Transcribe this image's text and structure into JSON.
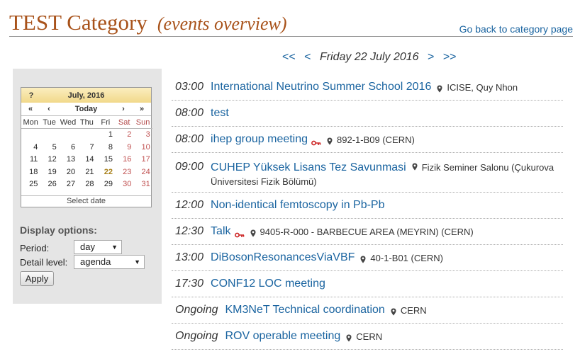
{
  "header": {
    "title": "TEST Category",
    "subtitle": "(events overview)",
    "back_link": "Go back to category page"
  },
  "date_nav": {
    "first": "<<",
    "prev": "<",
    "current": "Friday 22 July 2016",
    "next": ">",
    "last": ">>"
  },
  "calendar": {
    "help": "?",
    "month": "July, 2016",
    "nav_prev_year": "«",
    "nav_prev_month": "‹",
    "today": "Today",
    "nav_next_month": "›",
    "nav_next_year": "»",
    "weekdays": [
      "Mon",
      "Tue",
      "Wed",
      "Thu",
      "Fri",
      "Sat",
      "Sun"
    ],
    "weeks": [
      [
        "",
        "",
        "",
        "",
        "1",
        "2",
        "3"
      ],
      [
        "4",
        "5",
        "6",
        "7",
        "8",
        "9",
        "10"
      ],
      [
        "11",
        "12",
        "13",
        "14",
        "15",
        "16",
        "17"
      ],
      [
        "18",
        "19",
        "20",
        "21",
        "22",
        "23",
        "24"
      ],
      [
        "25",
        "26",
        "27",
        "28",
        "29",
        "30",
        "31"
      ]
    ],
    "selected_day": "22",
    "footer": "Select date"
  },
  "options": {
    "title": "Display options:",
    "period_label": "Period:",
    "period_value": "day",
    "detail_label": "Detail level:",
    "detail_value": "agenda",
    "apply_label": "Apply"
  },
  "events": [
    {
      "time": "03:00",
      "title": "International Neutrino Summer School 2016",
      "protected": false,
      "location": "ICISE, Quy Nhon"
    },
    {
      "time": "08:00",
      "title": "test",
      "protected": false,
      "location": ""
    },
    {
      "time": "08:00",
      "title": "ihep group meeting",
      "protected": true,
      "location": "892-1-B09 (CERN)"
    },
    {
      "time": "09:00",
      "title": "CUHEP Yüksek Lisans Tez Savunmasi",
      "protected": false,
      "location": "Fizik Seminer Salonu (Çukurova Üniversitesi Fizik Bölümü)"
    },
    {
      "time": "12:00",
      "title": "Non-identical femtoscopy in Pb-Pb",
      "protected": false,
      "location": ""
    },
    {
      "time": "12:30",
      "title": "Talk",
      "protected": true,
      "location": "9405-R-000 - BARBECUE AREA (MEYRIN) (CERN)"
    },
    {
      "time": "13:00",
      "title": "DiBosonResonancesViaVBF",
      "protected": false,
      "location": "40-1-B01 (CERN)"
    },
    {
      "time": "17:30",
      "title": "CONF12 LOC meeting",
      "protected": false,
      "location": ""
    },
    {
      "time": "Ongoing",
      "title": "KM3NeT Technical coordination",
      "protected": false,
      "location": "CERN"
    },
    {
      "time": "Ongoing",
      "title": "ROV operable meeting",
      "protected": false,
      "location": "CERN"
    }
  ],
  "colors": {
    "title": "#a8521a",
    "link": "#1a64a0",
    "weekend": "#c05050",
    "key_icon": "#cc2222"
  },
  "icons": {
    "location": "map-pin-icon",
    "protected": "key-icon"
  }
}
